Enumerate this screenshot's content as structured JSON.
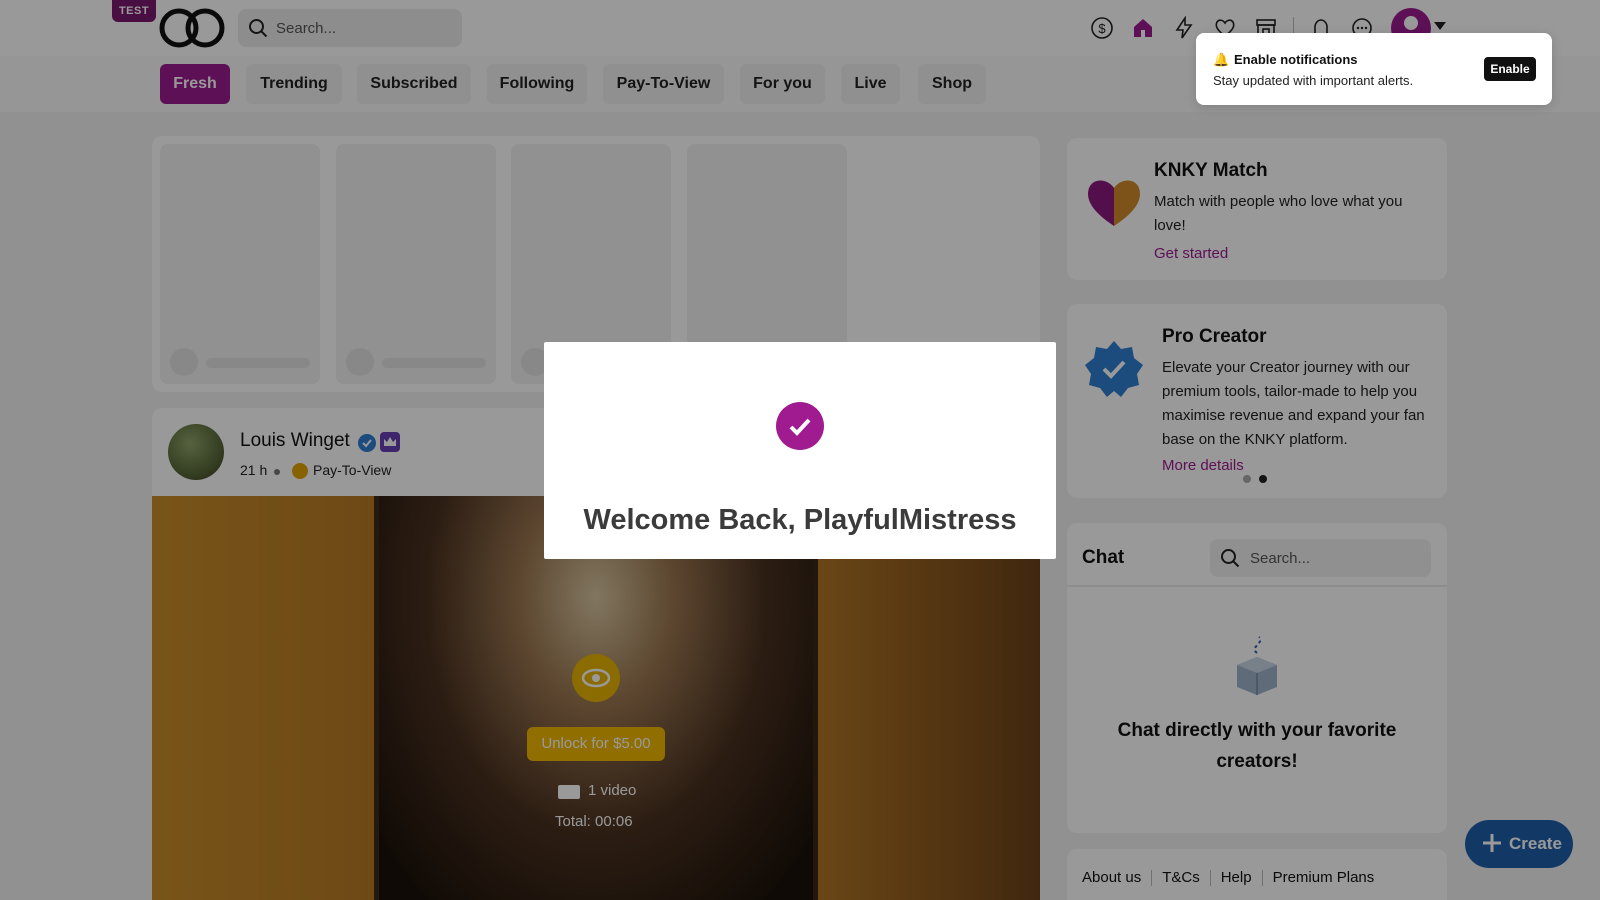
{
  "header": {
    "test_badge": "TEST",
    "search_placeholder": "Search...",
    "icons": [
      "dollar-icon",
      "home-icon",
      "bolt-icon",
      "heart-icon",
      "store-icon",
      "bell-icon",
      "chat-icon"
    ]
  },
  "tabs": [
    {
      "label": "Fresh",
      "active": true
    },
    {
      "label": "Trending",
      "active": false
    },
    {
      "label": "Subscribed",
      "active": false
    },
    {
      "label": "Following",
      "active": false
    },
    {
      "label": "Pay-To-View",
      "active": false
    },
    {
      "label": "For you",
      "active": false
    },
    {
      "label": "Live",
      "active": false
    },
    {
      "label": "Shop",
      "active": false
    }
  ],
  "post": {
    "author": "Louis Winget",
    "time": "21 h",
    "access": "Pay-To-View",
    "unlock_label": "Unlock for $5.00",
    "video_count": "1 video",
    "total": "Total: 00:06"
  },
  "match_card": {
    "title": "KNKY Match",
    "text": "Match with people who love what you love!",
    "link": "Get started"
  },
  "pro_card": {
    "title": "Pro Creator",
    "text": "Elevate your Creator journey with our premium tools, tailor-made to help you maximise revenue and expand your fan base on the KNKY platform.",
    "link": "More details"
  },
  "chat": {
    "title": "Chat",
    "search_placeholder": "Search...",
    "empty_text": "Chat directly with your favorite creators!"
  },
  "footer": {
    "links": [
      "About us",
      "T&Cs",
      "Help",
      "Premium Plans"
    ]
  },
  "create_button": "Create",
  "modal": {
    "title": "Welcome Back, PlayfulMistress"
  },
  "notification": {
    "title": "Enable notifications",
    "text": "Stay updated with important alerts.",
    "button": "Enable"
  },
  "colors": {
    "brand": "#9b1b8e",
    "create": "#1f5fa8",
    "unlock": "#f0b800"
  }
}
